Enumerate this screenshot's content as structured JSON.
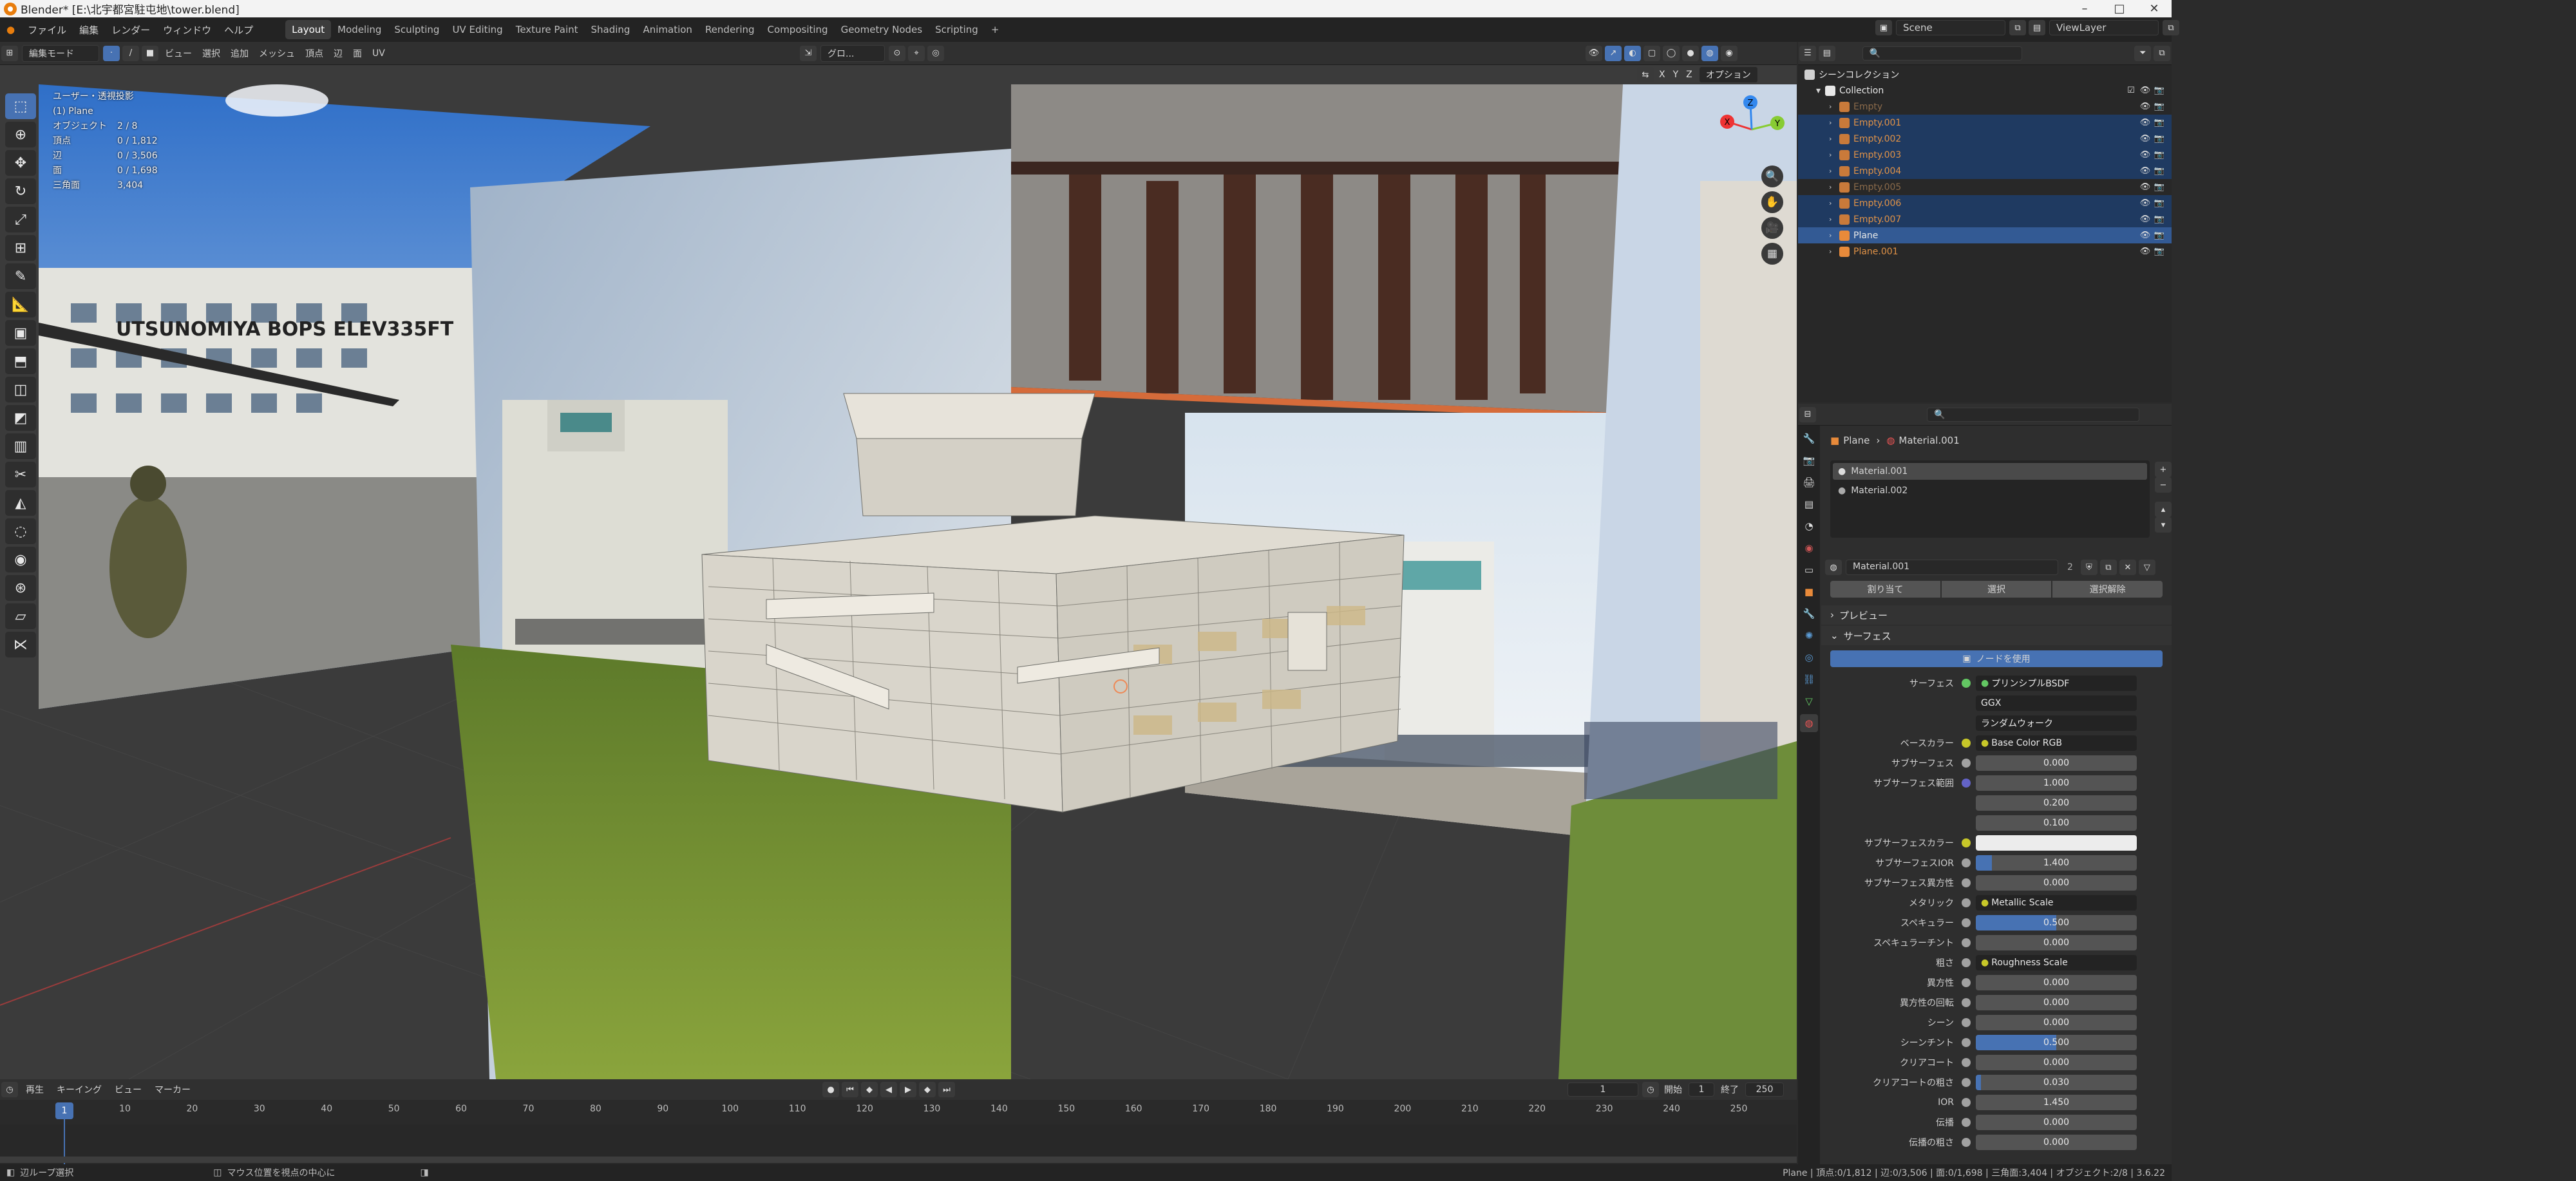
{
  "window": {
    "title": "Blender* [E:\\北宇都宮駐屯地\\tower.blend]",
    "min": "–",
    "max": "□",
    "close": "✕"
  },
  "menubar": [
    "ファイル",
    "編集",
    "レンダー",
    "ウィンドウ",
    "ヘルプ"
  ],
  "workspaces": [
    "Layout",
    "Modeling",
    "Sculpting",
    "UV Editing",
    "Texture Paint",
    "Shading",
    "Animation",
    "Rendering",
    "Compositing",
    "Geometry Nodes",
    "Scripting",
    "+"
  ],
  "active_workspace": "Layout",
  "scene": {
    "scene_name": "Scene",
    "view_layer": "ViewLayer"
  },
  "viewport_header": {
    "mode": "編集モード",
    "menus": [
      "ビュー",
      "選択",
      "追加",
      "メッシュ",
      "頂点",
      "辺",
      "面",
      "UV"
    ],
    "transform": "グロ...",
    "options": "オプション",
    "axes": [
      "X",
      "Y",
      "Z"
    ]
  },
  "viewport_info": {
    "title": "ユーザー・透視投影",
    "object": "(1) Plane",
    "rows": [
      [
        "オブジェクト",
        "2 / 8"
      ],
      [
        "頂点",
        "0 / 1,812"
      ],
      [
        "辺",
        "0 / 3,506"
      ],
      [
        "面",
        "0 / 1,698"
      ],
      [
        "三角面",
        "3,404"
      ]
    ]
  },
  "viewport_text": {
    "sign": "UTSUNOMIYA BOPS ELEV335FT"
  },
  "toolbar_icons": [
    "select-box-icon",
    "cursor-icon",
    "move-icon",
    "rotate-icon",
    "scale-icon",
    "transform-icon",
    "annotate-icon",
    "measure-icon",
    "add-cube-icon",
    "extrude-icon",
    "inset-icon",
    "bevel-icon",
    "loop-cut-icon",
    "knife-icon",
    "poly-build-icon",
    "spin-icon",
    "smooth-icon",
    "shrink-icon",
    "shear-icon",
    "rip-icon"
  ],
  "gizmo": {
    "x": "X",
    "y": "Y",
    "z": "Z"
  },
  "timeline": {
    "menus": [
      "再生",
      "キーイング",
      "ビュー",
      "マーカー"
    ],
    "current_frame": "1",
    "start_label": "開始",
    "start": "1",
    "end_label": "終了",
    "end": "250",
    "ticks": [
      "1",
      "10",
      "20",
      "30",
      "40",
      "50",
      "60",
      "70",
      "80",
      "90",
      "100",
      "110",
      "120",
      "130",
      "140",
      "150",
      "160",
      "170",
      "180",
      "190",
      "200",
      "210",
      "220",
      "230",
      "240",
      "250"
    ]
  },
  "statusbar": {
    "left": "辺ループ選択",
    "mid": "マウス位置を視点の中心に",
    "right": "Plane | 頂点:0/1,812 | 辺:0/3,506 | 面:0/1,698 | 三角面:3,404 | オブジェクト:2/8 | 3.6.22"
  },
  "outliner": {
    "root": "シーンコレクション",
    "collection": "Collection",
    "items": [
      {
        "name": "Empty",
        "state": "dim"
      },
      {
        "name": "Empty.001",
        "state": "sel"
      },
      {
        "name": "Empty.002",
        "state": "sel"
      },
      {
        "name": "Empty.003",
        "state": "sel"
      },
      {
        "name": "Empty.004",
        "state": "sel"
      },
      {
        "name": "Empty.005",
        "state": "dim"
      },
      {
        "name": "Empty.006",
        "state": "sel"
      },
      {
        "name": "Empty.007",
        "state": "sel"
      },
      {
        "name": "Plane",
        "state": "act"
      },
      {
        "name": "Plane.001",
        "state": "none"
      }
    ]
  },
  "properties": {
    "breadcrumb_obj": "Plane",
    "breadcrumb_mat": "Material.001",
    "slots": [
      "Material.001",
      "Material.002"
    ],
    "material_name": "Material.001",
    "users": "2",
    "buttons": [
      "割り当て",
      "選択",
      "選択解除"
    ],
    "preview": "プレビュー",
    "surface": "サーフェス",
    "use_nodes": "ノードを使用",
    "rows": [
      {
        "label": "サーフェス",
        "type": "shader",
        "value": "プリンシプルBSDF",
        "dot": "#63c763"
      },
      {
        "label": "",
        "type": "enum",
        "value": "GGX"
      },
      {
        "label": "",
        "type": "enum",
        "value": "ランダムウォーク"
      },
      {
        "label": "ベースカラー",
        "type": "link",
        "value": "Base Color RGB",
        "dot": "#c7c729"
      },
      {
        "label": "サブサーフェス",
        "type": "num",
        "value": "0.000",
        "dot": "#a1a1a1",
        "fill": 0
      },
      {
        "label": "サブサーフェス範囲",
        "type": "num",
        "value": "1.000",
        "dot": "#6363c7",
        "fill": 0
      },
      {
        "label": "",
        "type": "num",
        "value": "0.200",
        "fill": 0
      },
      {
        "label": "",
        "type": "num",
        "value": "0.100",
        "fill": 0
      },
      {
        "label": "サブサーフェスカラー",
        "type": "color",
        "value": "",
        "dot": "#c7c729"
      },
      {
        "label": "サブサーフェスIOR",
        "type": "num",
        "value": "1.400",
        "dot": "#a1a1a1",
        "fill": 0.1
      },
      {
        "label": "サブサーフェス異方性",
        "type": "num",
        "value": "0.000",
        "dot": "#a1a1a1",
        "fill": 0
      },
      {
        "label": "メタリック",
        "type": "link",
        "value": "Metallic Scale",
        "dot": "#a1a1a1"
      },
      {
        "label": "スペキュラー",
        "type": "num",
        "value": "0.500",
        "dot": "#a1a1a1",
        "fill": 0.5
      },
      {
        "label": "スペキュラーチント",
        "type": "num",
        "value": "0.000",
        "dot": "#a1a1a1",
        "fill": 0
      },
      {
        "label": "粗さ",
        "type": "link",
        "value": "Roughness Scale",
        "dot": "#a1a1a1"
      },
      {
        "label": "異方性",
        "type": "num",
        "value": "0.000",
        "dot": "#a1a1a1",
        "fill": 0
      },
      {
        "label": "異方性の回転",
        "type": "num",
        "value": "0.000",
        "dot": "#a1a1a1",
        "fill": 0
      },
      {
        "label": "シーン",
        "type": "num",
        "value": "0.000",
        "dot": "#a1a1a1",
        "fill": 0
      },
      {
        "label": "シーンチント",
        "type": "num",
        "value": "0.500",
        "dot": "#a1a1a1",
        "fill": 0.5
      },
      {
        "label": "クリアコート",
        "type": "num",
        "value": "0.000",
        "dot": "#a1a1a1",
        "fill": 0
      },
      {
        "label": "クリアコートの粗さ",
        "type": "num",
        "value": "0.030",
        "dot": "#a1a1a1",
        "fill": 0.03
      },
      {
        "label": "IOR",
        "type": "num",
        "value": "1.450",
        "dot": "#a1a1a1",
        "fill": 0
      },
      {
        "label": "伝播",
        "type": "num",
        "value": "0.000",
        "dot": "#a1a1a1",
        "fill": 0
      },
      {
        "label": "伝播の粗さ",
        "type": "num",
        "value": "0.000",
        "dot": "#a1a1a1",
        "fill": 0
      }
    ]
  },
  "colors": {
    "accent": "#4772b3",
    "object_orange": "#e09247"
  }
}
